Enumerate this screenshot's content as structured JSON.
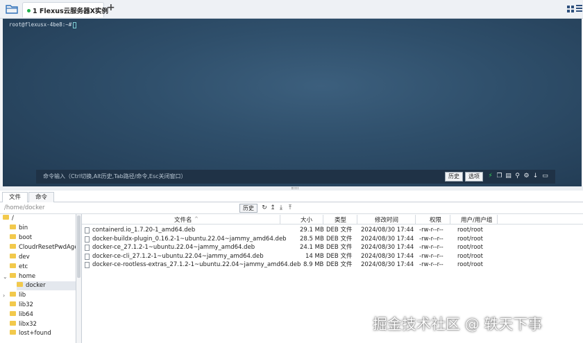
{
  "tab": {
    "title": "1 Flexus云服务器X实例",
    "close": "×",
    "add": "+"
  },
  "terminal": {
    "prompt": "root@flexusx-4be8:~#",
    "cmd_hint": "命令输入（Ctrl切换,Alt历史,Tab路径/命令,Esc关闭窗口）",
    "history_btn": "历史",
    "options_btn": "选项"
  },
  "panel_tabs": [
    "文件",
    "命令"
  ],
  "pathbar": {
    "path": "/home/docker",
    "history_btn": "历史"
  },
  "tree": [
    {
      "label": "/",
      "level": 0,
      "expanded": true
    },
    {
      "label": "bin",
      "level": 1
    },
    {
      "label": "boot",
      "level": 1
    },
    {
      "label": "CloudrResetPwdAgent",
      "level": 1
    },
    {
      "label": "dev",
      "level": 1
    },
    {
      "label": "etc",
      "level": 1
    },
    {
      "label": "home",
      "level": 1,
      "expanded": true
    },
    {
      "label": "docker",
      "level": 2,
      "selected": true
    },
    {
      "label": "lib",
      "level": 1,
      "collapsed": true
    },
    {
      "label": "lib32",
      "level": 1
    },
    {
      "label": "lib64",
      "level": 1
    },
    {
      "label": "libx32",
      "level": 1
    },
    {
      "label": "lost+found",
      "level": 1
    }
  ],
  "columns": {
    "name": "文件名",
    "size": "大小",
    "type": "类型",
    "mtime": "修改时间",
    "perm": "权限",
    "owner": "用户/用户组"
  },
  "files": [
    {
      "name": "containerd.io_1.7.20-1_amd64.deb",
      "size": "29.1 MB",
      "type": "DEB 文件",
      "mtime": "2024/08/30 17:44",
      "perm": "-rw-r--r--",
      "owner": "root/root"
    },
    {
      "name": "docker-buildx-plugin_0.16.2-1~ubuntu.22.04~jammy_amd64.deb",
      "size": "28.5 MB",
      "type": "DEB 文件",
      "mtime": "2024/08/30 17:44",
      "perm": "-rw-r--r--",
      "owner": "root/root"
    },
    {
      "name": "docker-ce_27.1.2-1~ubuntu.22.04~jammy_amd64.deb",
      "size": "24.1 MB",
      "type": "DEB 文件",
      "mtime": "2024/08/30 17:44",
      "perm": "-rw-r--r--",
      "owner": "root/root"
    },
    {
      "name": "docker-ce-cli_27.1.2-1~ubuntu.22.04~jammy_amd64.deb",
      "size": "14 MB",
      "type": "DEB 文件",
      "mtime": "2024/08/30 17:44",
      "perm": "-rw-r--r--",
      "owner": "root/root"
    },
    {
      "name": "docker-ce-rootless-extras_27.1.2-1~ubuntu.22.04~jammy_amd64.deb",
      "size": "8.9 MB",
      "type": "DEB 文件",
      "mtime": "2024/08/30 17:44",
      "perm": "-rw-r--r--",
      "owner": "root/root"
    }
  ],
  "watermark": "掘金技术社区 @ 轶天下事",
  "colors": {
    "terminal_bg": "#2f4f6b",
    "folder": "#f2c94c",
    "active_dot": "#22b14c"
  }
}
